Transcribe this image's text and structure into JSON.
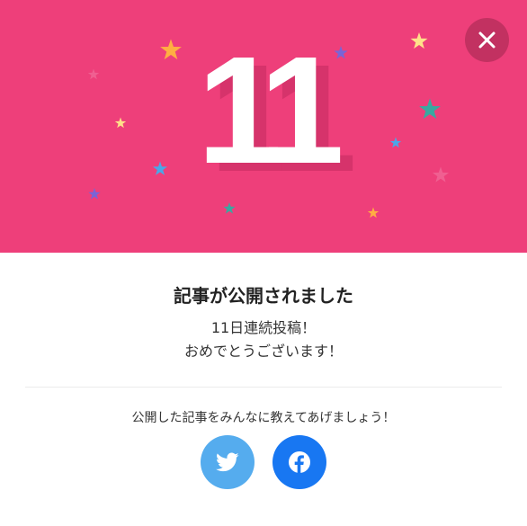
{
  "hero": {
    "day_count": "11",
    "background_color": "#ee3f7a"
  },
  "close_icon": "close-icon",
  "dialog": {
    "title": "記事が公開されました",
    "message_line1": "11日連続投稿！",
    "message_line2": "おめでとうございます！",
    "share_prompt": "公開した記事をみんなに教えてあげましょう！"
  },
  "share_buttons": [
    {
      "icon": "twitter-icon",
      "color": "#55acee"
    },
    {
      "icon": "facebook-icon",
      "color": "#1877f2"
    }
  ],
  "star_colors": [
    "#ffc845",
    "#ffae42",
    "#3aa8a0",
    "#4aa7e8",
    "#7a64d6",
    "#f06b9a"
  ]
}
